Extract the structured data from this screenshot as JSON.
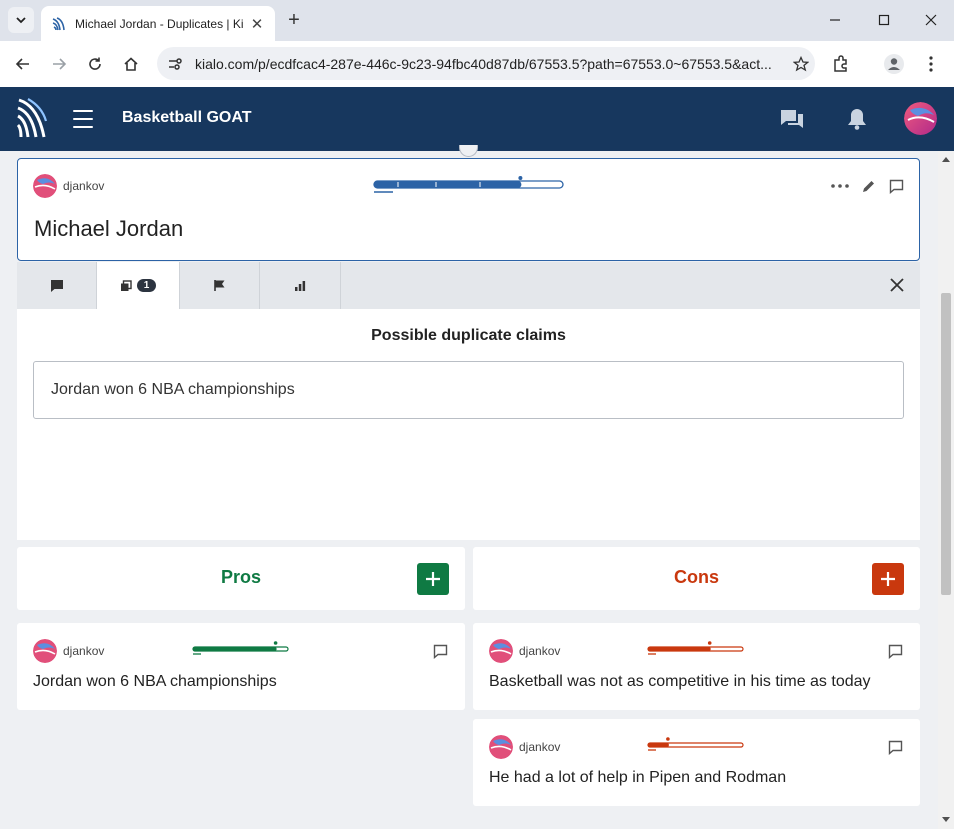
{
  "browser": {
    "tab_title": "Michael Jordan - Duplicates | Ki",
    "tab_close": "✕",
    "new_tab": "+",
    "url": "kialo.com/p/ecdfcac4-287e-446c-9c23-94fbc40d87db/67553.5?path=67553.0~67553.5&act..."
  },
  "header": {
    "title": "Basketball GOAT"
  },
  "claim": {
    "author": "djankov",
    "text": "Michael Jordan",
    "vote_fraction": 0.78
  },
  "panel": {
    "duplicates_count": "1",
    "heading": "Possible duplicate claims",
    "duplicates": [
      {
        "text": "Jordan won 6 NBA championships"
      }
    ]
  },
  "pros": {
    "title": "Pros",
    "add_label": "+",
    "items": [
      {
        "author": "djankov",
        "text": "Jordan won 6 NBA championships",
        "vote_fraction": 0.88
      }
    ]
  },
  "cons": {
    "title": "Cons",
    "add_label": "+",
    "items": [
      {
        "author": "djankov",
        "text": "Basketball was not as competitive in his time as today",
        "vote_fraction": 0.66
      },
      {
        "author": "djankov",
        "text": "He had a lot of help in Pipen and Rodman",
        "vote_fraction": 0.22
      }
    ]
  },
  "colors": {
    "header_bg": "#17375e",
    "claim_accent": "#2c63a6",
    "pro": "#0f7a43",
    "con": "#c9380e"
  }
}
